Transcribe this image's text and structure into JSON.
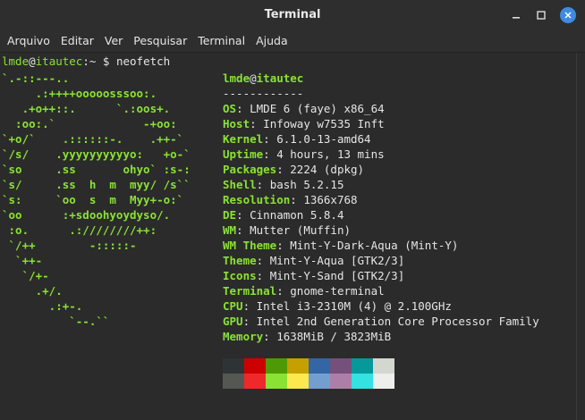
{
  "window": {
    "title": "Terminal"
  },
  "menu": [
    "Arquivo",
    "Editar",
    "Ver",
    "Pesquisar",
    "Terminal",
    "Ajuda"
  ],
  "prompt": {
    "user": "lmde",
    "at": "@",
    "host": "itautec",
    "sep": ":~",
    "symbol": "$",
    "command": "neofetch"
  },
  "ascii_art": [
    "`.-::---..",
    "     .:++++ooooosssoo:.",
    "   .+o++::.      `.:oos+.",
    "  :oo:.`             -+oo:",
    "`+o/`    .::::::-.    .++-`",
    "`/s/    .yyyyyyyyyyo:   +o-`",
    "`so     .ss       ohyo` :s-:",
    "`s/     .ss  h  m  myy/ /s``",
    "`s:     `oo  s  m  Myy+-o:`",
    "`oo      :+sdoohyoydyso/.",
    " :o.      .:////////++:",
    " `/++        -:::::-",
    "  `++-",
    "   `/+-",
    "     .+/.",
    "       .:+-.",
    "          `--.``"
  ],
  "header": {
    "user": "lmde",
    "at": "@",
    "host": "itautec",
    "underline": "------------"
  },
  "info": [
    {
      "key": "OS",
      "value": "LMDE 6 (faye) x86_64"
    },
    {
      "key": "Host",
      "value": "Infoway w7535 Inft"
    },
    {
      "key": "Kernel",
      "value": "6.1.0-13-amd64"
    },
    {
      "key": "Uptime",
      "value": "4 hours, 13 mins"
    },
    {
      "key": "Packages",
      "value": "2224 (dpkg)"
    },
    {
      "key": "Shell",
      "value": "bash 5.2.15"
    },
    {
      "key": "Resolution",
      "value": "1366x768"
    },
    {
      "key": "DE",
      "value": "Cinnamon 5.8.4"
    },
    {
      "key": "WM",
      "value": "Mutter (Muffin)"
    },
    {
      "key": "WM Theme",
      "value": "Mint-Y-Dark-Aqua (Mint-Y)"
    },
    {
      "key": "Theme",
      "value": "Mint-Y-Aqua [GTK2/3]"
    },
    {
      "key": "Icons",
      "value": "Mint-Y-Sand [GTK2/3]"
    },
    {
      "key": "Terminal",
      "value": "gnome-terminal"
    },
    {
      "key": "CPU",
      "value": "Intel i3-2310M (4) @ 2.100GHz"
    },
    {
      "key": "GPU",
      "value": "Intel 2nd Generation Core Processor Family"
    },
    {
      "key": "Memory",
      "value": "1638MiB / 3823MiB"
    }
  ],
  "palette": {
    "normal": [
      "#2e3436",
      "#cc0000",
      "#4e9a06",
      "#c4a000",
      "#3465a4",
      "#75507b",
      "#06989a",
      "#d3d7cf"
    ],
    "bright": [
      "#555753",
      "#ef2929",
      "#8ae234",
      "#fce94f",
      "#729fcf",
      "#ad7fa8",
      "#34e2e2",
      "#eeeeec"
    ]
  },
  "colors": {
    "accent_green": "#8ae234",
    "background": "#2b2b2b",
    "close_button": "#3f8ae0"
  },
  "icons": {
    "minimize": "minimize-icon",
    "maximize": "maximize-icon",
    "close": "close-icon"
  }
}
